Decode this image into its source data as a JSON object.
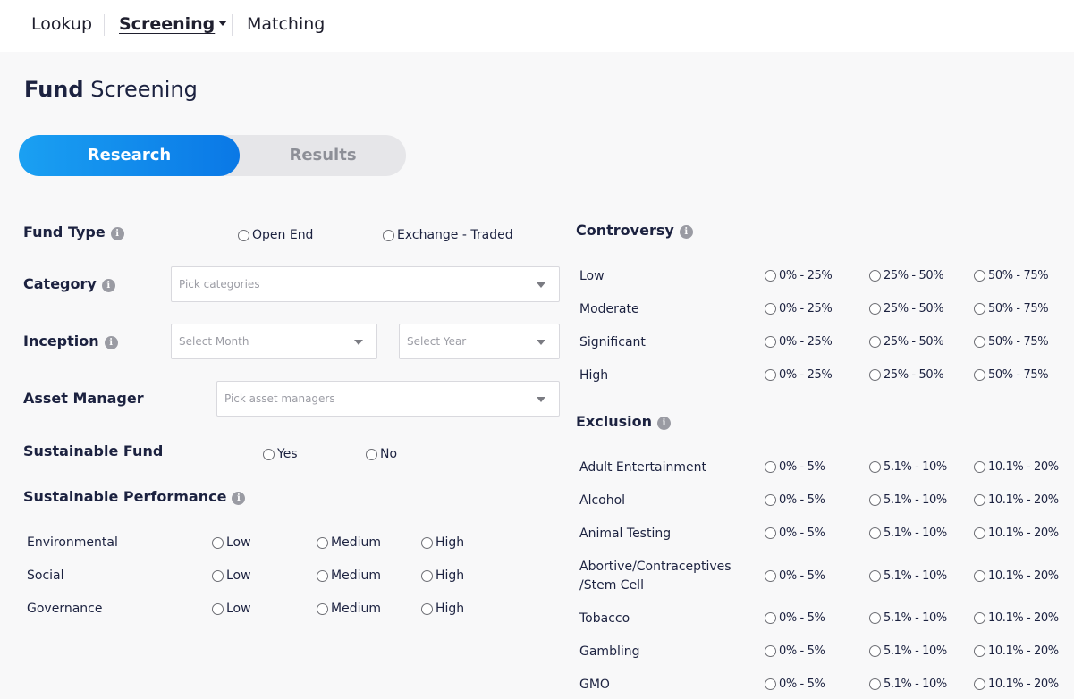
{
  "nav": {
    "lookup": "Lookup",
    "screening": "Screening",
    "matching": "Matching"
  },
  "page": {
    "title_bold": "Fund",
    "title_rest": "Screening"
  },
  "tabs": {
    "research": "Research",
    "results": "Results"
  },
  "form": {
    "fund_type": {
      "label": "Fund Type",
      "options": [
        "Open End",
        "Exchange - Traded"
      ]
    },
    "category": {
      "label": "Category",
      "placeholder": "Pick categories"
    },
    "inception": {
      "label": "Inception",
      "month_placeholder": "Select Month",
      "year_placeholder": "Select Year"
    },
    "asset_manager": {
      "label": "Asset Manager",
      "placeholder": "Pick asset managers"
    },
    "sustainable_fund": {
      "label": "Sustainable Fund",
      "options": [
        "Yes",
        "No"
      ]
    },
    "sustainable_performance": {
      "label": "Sustainable Performance",
      "options": [
        "Low",
        "Medium",
        "High"
      ],
      "rows": [
        "Environmental",
        "Social",
        "Governance"
      ]
    }
  },
  "controversy": {
    "label": "Controversy",
    "options": [
      "0% - 25%",
      "25% - 50%",
      "50% - 75%"
    ],
    "rows": [
      "Low",
      "Moderate",
      "Significant",
      "High"
    ]
  },
  "exclusion": {
    "label": "Exclusion",
    "options": [
      "0% - 5%",
      "5.1% - 10%",
      "10.1% - 20%"
    ],
    "rows": [
      "Adult Entertainment",
      "Alcohol",
      "Animal Testing",
      "Abortive/Contraceptives /Stem Cell",
      "Tobacco",
      "Gambling",
      "GMO"
    ]
  },
  "icons": {
    "info": "info-icon",
    "dropdown": "chevron-down-icon",
    "nav_caret": "caret-down-icon"
  },
  "colors": {
    "accent": "#0a78e6",
    "accent_light": "#1aa0f2",
    "text": "#1c2240",
    "tab_inactive_bg": "#e6e6e9"
  }
}
